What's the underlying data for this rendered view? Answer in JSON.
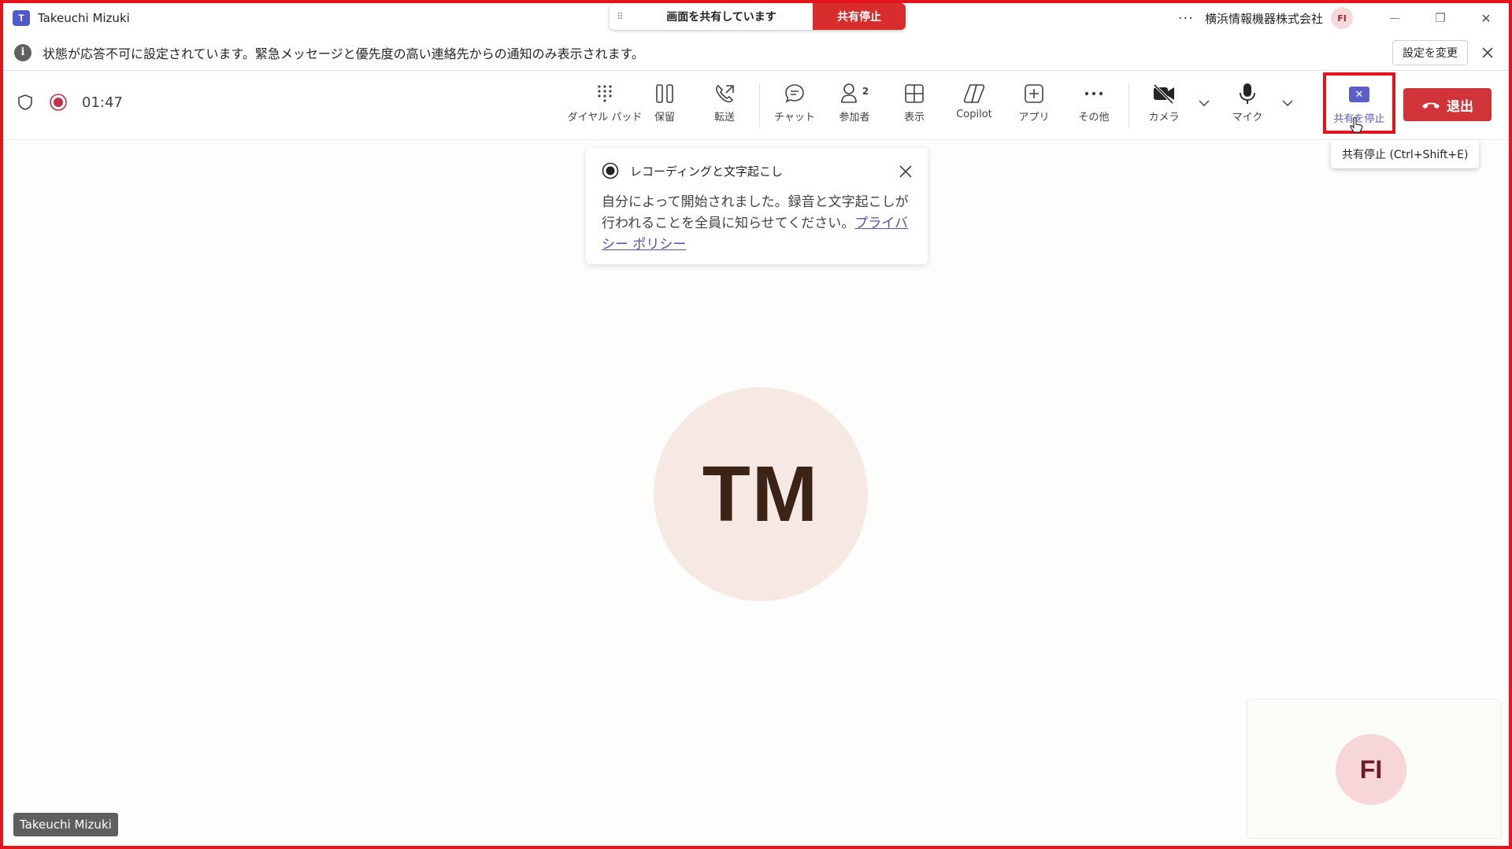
{
  "window": {
    "title": "Takeuchi Mizuki",
    "app_logo": "T",
    "organization": "横浜情報機器株式会社",
    "org_avatar": "FI",
    "more_dots": "···",
    "minimize": "—",
    "restore": "❐",
    "close": "✕"
  },
  "share_bar": {
    "grip": "⠿",
    "status": "画面を共有しています",
    "stop_label": "共有停止"
  },
  "banner": {
    "info_glyph": "i",
    "message": "状態が応答不可に設定されています。緊急メッセージと優先度の高い連絡先からの通知のみ表示されます。",
    "change_settings": "設定を変更"
  },
  "call": {
    "timer": "01:47",
    "toolbar": [
      {
        "id": "dialpad",
        "label": "ダイヤル パッド",
        "icon": "dialpad-icon"
      },
      {
        "id": "hold",
        "label": "保留",
        "icon": "pause-icon"
      },
      {
        "id": "transfer",
        "label": "転送",
        "icon": "phone-forward-icon"
      },
      {
        "id": "chat",
        "label": "チャット",
        "icon": "chat-icon"
      },
      {
        "id": "participants",
        "label": "参加者",
        "icon": "people-icon",
        "badge": "2"
      },
      {
        "id": "view",
        "label": "表示",
        "icon": "grid-icon"
      },
      {
        "id": "copilot",
        "label": "Copilot",
        "icon": "copilot-icon"
      },
      {
        "id": "apps",
        "label": "アプリ",
        "icon": "add-app-icon"
      },
      {
        "id": "more",
        "label": "その他",
        "icon": "more-icon"
      },
      {
        "id": "camera",
        "label": "カメラ",
        "icon": "camera-off-icon"
      },
      {
        "id": "mic",
        "label": "マイク",
        "icon": "mic-icon"
      }
    ],
    "stop_share_label": "共有を停止",
    "stop_share_glyph": "✕",
    "leave_label": "退出",
    "tooltip": "共有停止 (Ctrl+Shift+E)"
  },
  "recording_card": {
    "title": "レコーディングと文字起こし",
    "body": "自分によって開始されました。録音と文字起こしが行われることを全員に知らせてください。",
    "link": "プライバシー ポリシー"
  },
  "stage": {
    "main_initials": "TM",
    "self_initials": "FI",
    "name_tag": "Takeuchi Mizuki"
  },
  "colors": {
    "frame": "#e3141e",
    "accent": "#5b5fc7",
    "leave": "#d13438",
    "share_stop": "#d92c2c"
  }
}
